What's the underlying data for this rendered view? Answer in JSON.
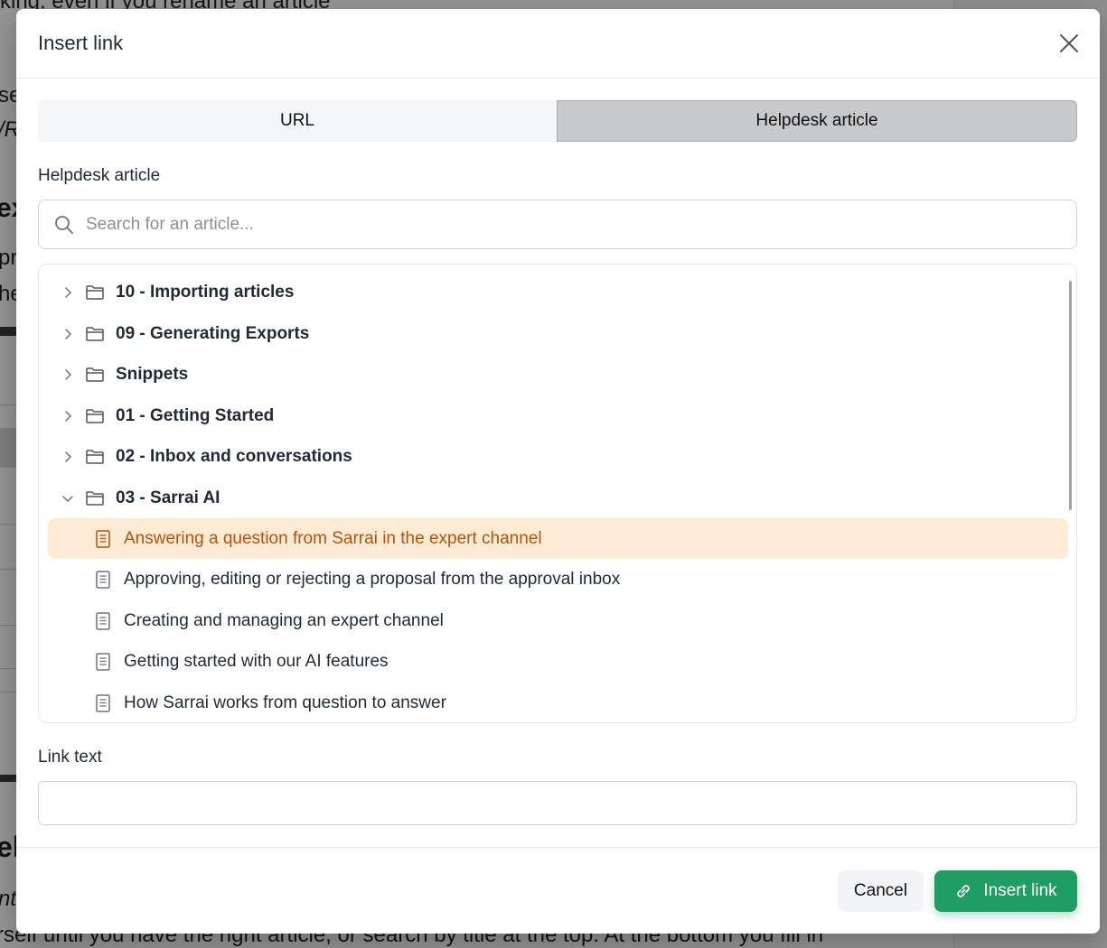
{
  "dialog": {
    "title": "Insert link"
  },
  "tabs": [
    {
      "label": "URL",
      "active": false
    },
    {
      "label": "Helpdesk article",
      "active": true
    }
  ],
  "article_field": {
    "label": "Helpdesk article",
    "search_placeholder": "Search for an article...",
    "search_value": ""
  },
  "tree": {
    "folders": [
      {
        "label": "10 - Importing articles",
        "expanded": false
      },
      {
        "label": "09 - Generating Exports",
        "expanded": false
      },
      {
        "label": "Snippets",
        "expanded": false
      },
      {
        "label": "01 - Getting Started",
        "expanded": false
      },
      {
        "label": "02 - Inbox and conversations",
        "expanded": false
      },
      {
        "label": "03 - Sarrai AI",
        "expanded": true
      }
    ],
    "articles": [
      {
        "label": "Answering a question from Sarrai in the expert channel",
        "selected": true
      },
      {
        "label": "Approving, editing or rejecting a proposal from the approval inbox",
        "selected": false
      },
      {
        "label": "Creating and managing an expert channel",
        "selected": false
      },
      {
        "label": "Getting started with our AI features",
        "selected": false
      },
      {
        "label": "How Sarrai works from question to answer",
        "selected": false
      }
    ]
  },
  "link_text": {
    "label": "Link text",
    "value": ""
  },
  "footer": {
    "cancel_label": "Cancel",
    "insert_label": "Insert link"
  },
  "background": {
    "lines": [
      "king, even if you rename an article",
      "se",
      "/R",
      "ex",
      "pr",
      "he",
      "el",
      "nt",
      "rself until you have the right article, or search by title at the top. At the bottom you fill in"
    ]
  },
  "colors": {
    "accent": "#1f9d63",
    "selected_bg": "#fdebd6",
    "selected_text": "#b45309"
  }
}
